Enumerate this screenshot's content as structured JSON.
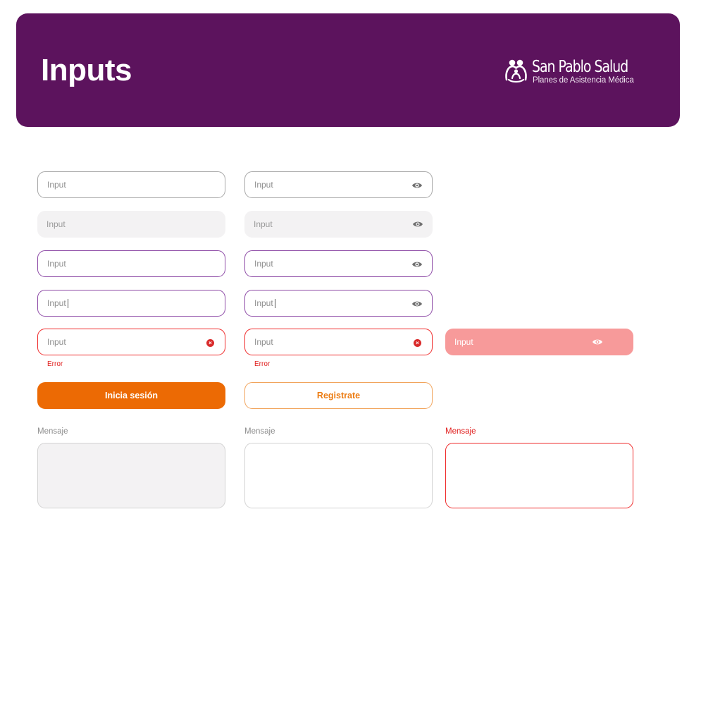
{
  "header": {
    "title": "Inputs",
    "brand_name": "San Pablo Salud",
    "brand_tagline": "Planes de Asistencia Médica",
    "logo_icon": "family-people-icon",
    "background_color": "#5c135d"
  },
  "inputs": {
    "default_text": {
      "placeholder": "Input"
    },
    "default_password": {
      "placeholder": "Input",
      "icon": "eye-icon"
    },
    "disabled_text": {
      "placeholder": "Input"
    },
    "disabled_password": {
      "placeholder": "Input",
      "icon": "eye-icon"
    },
    "focus_text": {
      "placeholder": "Input"
    },
    "focus_password": {
      "placeholder": "Input",
      "icon": "eye-icon"
    },
    "typing_text": {
      "placeholder": "Input"
    },
    "typing_password": {
      "placeholder": "Input",
      "icon": "eye-icon"
    },
    "error_text": {
      "placeholder": "Input",
      "icon": "error-x-icon",
      "error": "Error"
    },
    "error_password": {
      "placeholder": "Input",
      "icon": "error-x-icon",
      "error": "Error"
    },
    "error_filled": {
      "placeholder": "Input",
      "icon": "eye-icon"
    }
  },
  "buttons": {
    "login_label": "Inicia sesión",
    "register_label": "Registrate"
  },
  "textareas": {
    "disabled_label": "Mensaje",
    "default_label": "Mensaje",
    "error_label": "Mensaje"
  },
  "colors": {
    "brand_purple": "#5c135d",
    "focus_border": "#8d4aa6",
    "error_red": "#ef2b2b",
    "primary_orange": "#ec6a04"
  }
}
